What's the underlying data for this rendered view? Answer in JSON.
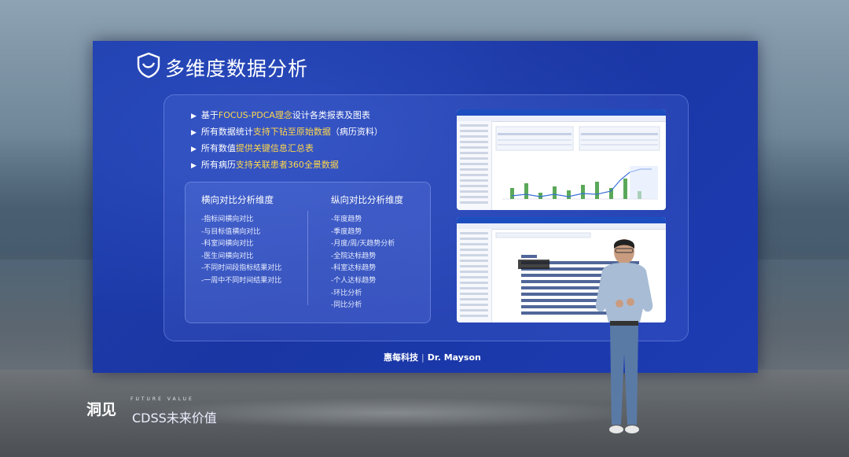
{
  "slide": {
    "title": "多维度数据分析",
    "bullets": [
      {
        "pre": "基于",
        "hl": "FOCUS-PDCA理念",
        "post": "设计各类报表及图表"
      },
      {
        "pre": "所有数据统计",
        "hl": "支持下钻至原始数据",
        "post": "（病历资料）"
      },
      {
        "pre": "所有数值",
        "hl": "提供关键信息汇总表",
        "post": ""
      },
      {
        "pre": "所有病历",
        "hl": "支持关联患者360全景数据",
        "post": ""
      }
    ],
    "horizontal": {
      "heading": "横向对比分析维度",
      "items": [
        "-指标间横向对比",
        "-与目标值横向对比",
        "-科室间横向对比",
        "-医生间横向对比",
        "-不同时间段指标结果对比",
        "-一周中不同时间结果对比"
      ]
    },
    "vertical": {
      "heading": "纵向对比分析维度",
      "items": [
        "-年度趋势",
        "-季度趋势",
        "-月度/周/天趋势分析",
        "-全院达标趋势",
        "-科室达标趋势",
        "-个人达标趋势",
        "-环比分析",
        "-同比分析"
      ]
    },
    "footer_logo": {
      "cn": "惠每科技",
      "en": "Dr. Mayson"
    }
  },
  "event_brand": {
    "cn": "洞见",
    "sub": "CDSS未来价值",
    "tiny": "FUTURE VALUE"
  },
  "colors": {
    "screen": "#1f3fae",
    "highlight": "#ffd84a",
    "text": "#ffffff"
  }
}
